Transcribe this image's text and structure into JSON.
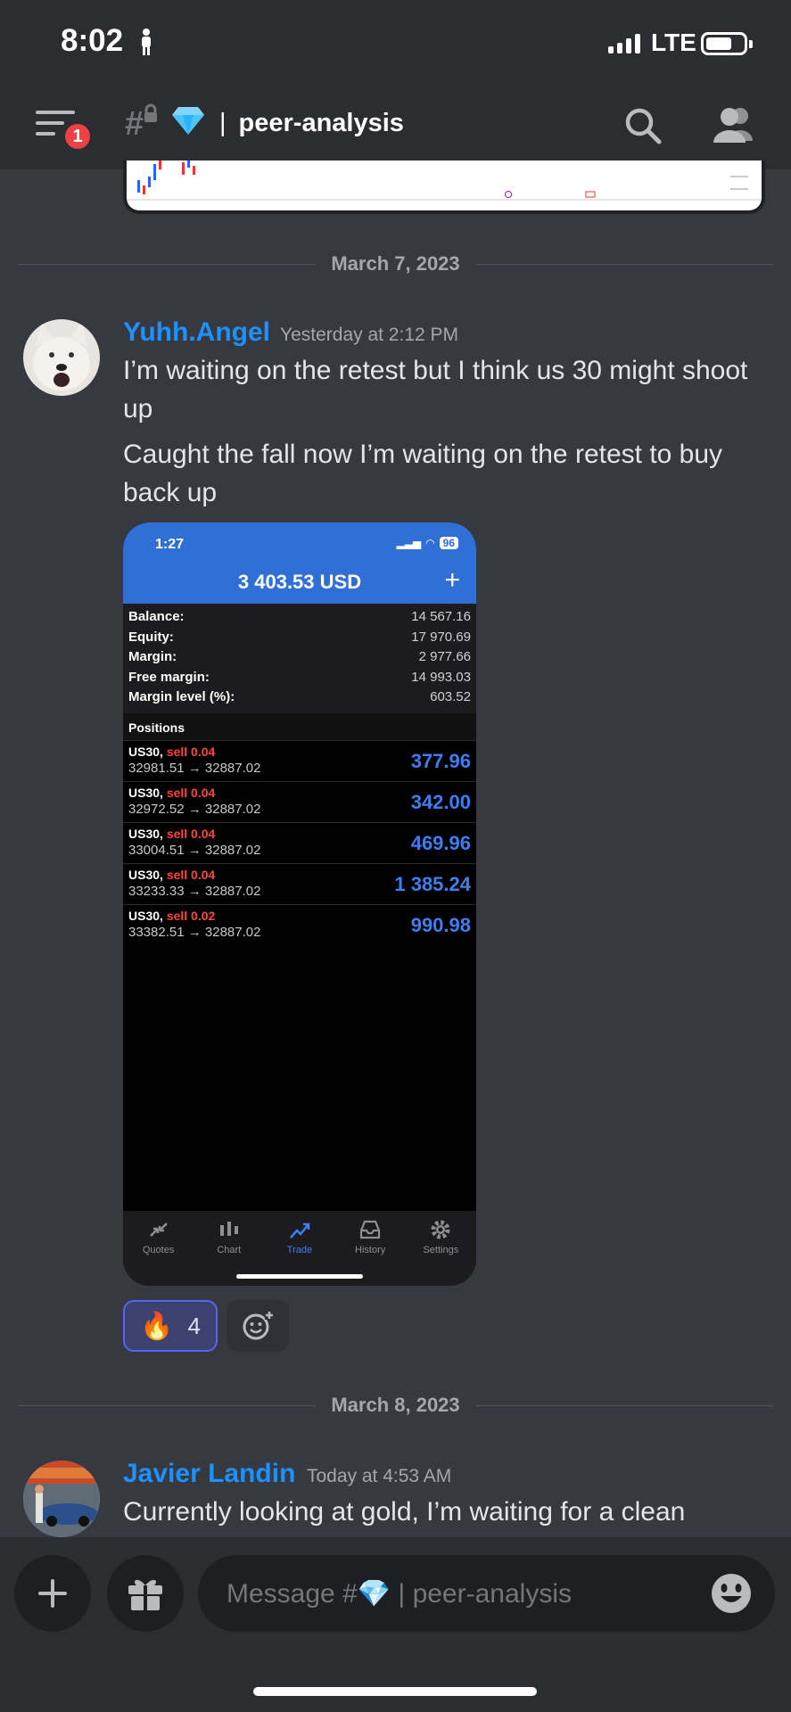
{
  "status_bar": {
    "time": "8:02",
    "network": "LTE"
  },
  "header": {
    "channel_name": "peer-analysis",
    "notification_count": "1"
  },
  "dividers": {
    "first": "March 7, 2023",
    "second": "March 8, 2023"
  },
  "messages": [
    {
      "author": "Yuhh.Angel",
      "timestamp": "Yesterday at 2:12 PM",
      "lines": [
        "I’m waiting on the retest but I think us 30 might shoot up",
        "Caught the fall now I’m waiting on the retest to buy back up"
      ]
    },
    {
      "author": "Javier Landin",
      "timestamp": "Today at 4:53 AM",
      "lines": [
        "Currently looking at gold, I’m waiting for a clean"
      ]
    }
  ],
  "attachment": {
    "time": "1:27",
    "battery": "96",
    "balance_header": "3 403.53 USD",
    "account": [
      {
        "label": "Balance:",
        "value": "14 567.16"
      },
      {
        "label": "Equity:",
        "value": "17 970.69"
      },
      {
        "label": "Margin:",
        "value": "2 977.66"
      },
      {
        "label": "Free margin:",
        "value": "14 993.03"
      },
      {
        "label": "Margin level (%):",
        "value": "603.52"
      }
    ],
    "positions_label": "Positions",
    "positions": [
      {
        "symbol": "US30,",
        "side": "sell 0.04",
        "prices": "32981.51 → 32887.02",
        "pl": "377.96"
      },
      {
        "symbol": "US30,",
        "side": "sell 0.04",
        "prices": "32972.52 → 32887.02",
        "pl": "342.00"
      },
      {
        "symbol": "US30,",
        "side": "sell 0.04",
        "prices": "33004.51 → 32887.02",
        "pl": "469.96"
      },
      {
        "symbol": "US30,",
        "side": "sell 0.04",
        "prices": "33233.33 → 32887.02",
        "pl": "1 385.24"
      },
      {
        "symbol": "US30,",
        "side": "sell 0.02",
        "prices": "33382.51 → 32887.02",
        "pl": "990.98"
      }
    ],
    "tabs": [
      "Quotes",
      "Chart",
      "Trade",
      "History",
      "Settings"
    ]
  },
  "reaction": {
    "emoji": "🔥",
    "count": "4"
  },
  "composer": {
    "placeholder": "Message #💎 | peer-analysis"
  },
  "colors": {
    "username": "#1e90ff",
    "background": "#36393f",
    "accent": "#5865f2"
  }
}
